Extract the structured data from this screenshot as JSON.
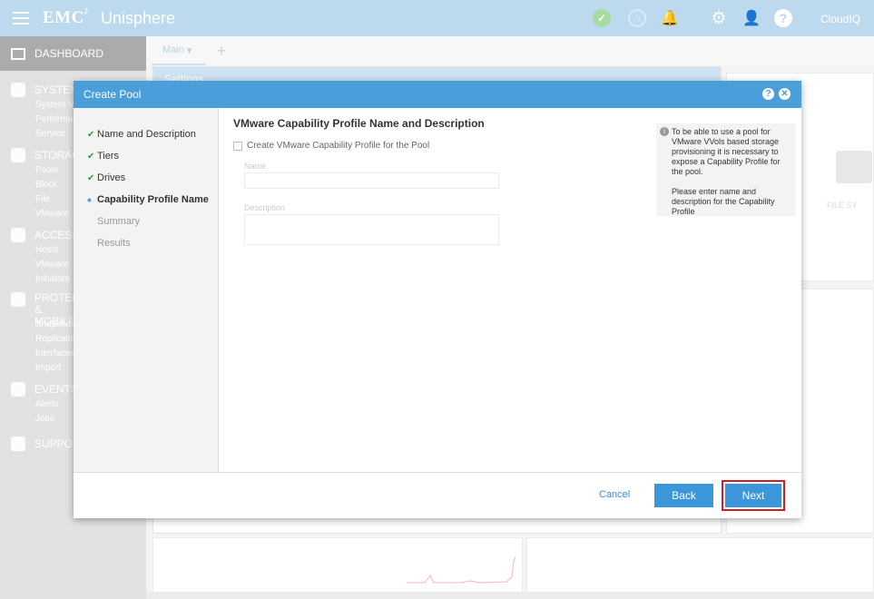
{
  "app": {
    "brand": "EMC",
    "brand_sup": "2",
    "product": "Unisphere",
    "cloud_label": "CloudIQ"
  },
  "sidebar": {
    "dashboard": "DASHBOARD",
    "sections": [
      {
        "label": "SYSTEM",
        "items": [
          "System View",
          "Performance",
          "Service"
        ]
      },
      {
        "label": "STORAGE",
        "items": [
          "Pools",
          "Block",
          "File",
          "VMware"
        ]
      },
      {
        "label": "ACCESS",
        "items": [
          "Hosts",
          "VMware",
          "Initiators"
        ]
      },
      {
        "label": "PROTECTION & MOBILITY",
        "items": [
          "Snapshot Schedule",
          "Replication",
          "Interfaces",
          "Import"
        ]
      },
      {
        "label": "EVENTS",
        "items": [
          "Alerts",
          "Jobs"
        ]
      },
      {
        "label": "SUPPORT",
        "items": []
      }
    ]
  },
  "tabs": {
    "main_label": "Main",
    "add_label": "+"
  },
  "background": {
    "panel_title": "Settings",
    "file_label": "FILE SY"
  },
  "dialog": {
    "title": "Create Pool",
    "steps": [
      {
        "label": "Name and Description",
        "state": "done"
      },
      {
        "label": "Tiers",
        "state": "done"
      },
      {
        "label": "Drives",
        "state": "done"
      },
      {
        "label": "Capability Profile Name",
        "state": "current"
      },
      {
        "label": "Summary",
        "state": "pending"
      },
      {
        "label": "Results",
        "state": "pending"
      }
    ],
    "section_title": "VMware Capability Profile Name and Description",
    "checkbox_label": "Create VMware Capability Profile for the Pool",
    "name_label": "Name",
    "description_label": "Description",
    "info_text_1": "To be able to use a pool for VMware VVols based storage provisioning it is necessary to expose a Capability Profile for the pool.",
    "info_text_2": "Please enter name and description for the Capability Profile",
    "cancel_label": "Cancel",
    "back_label": "Back",
    "next_label": "Next"
  },
  "colors": {
    "accent": "#4a9fda",
    "topbar": "#bcd9ee",
    "highlight": "#d21d25",
    "ok": "#a6dca0"
  }
}
